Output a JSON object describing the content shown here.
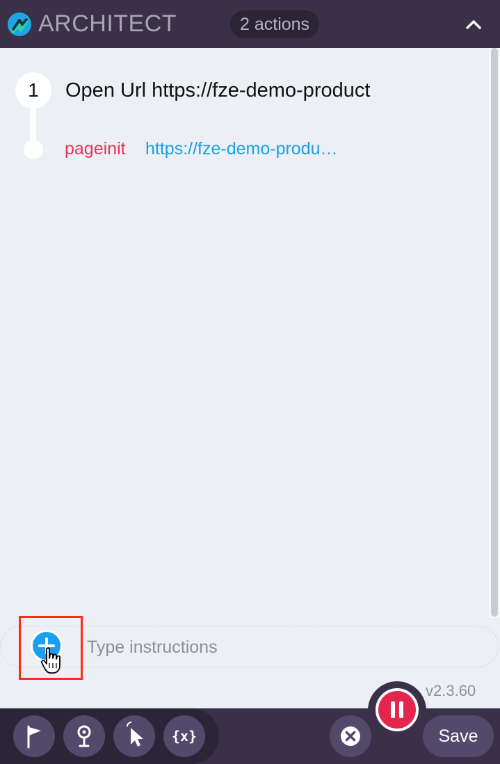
{
  "header": {
    "brand": "ARCHITECT",
    "actions_count": "2 actions",
    "logo_icon": "architect-logo-icon",
    "collapse_icon": "chevron-up-icon"
  },
  "steps": [
    {
      "number": "1",
      "title": "Open Url https://fze-demo-product",
      "event": {
        "name": "pageinit",
        "url": "https://fze-demo-produ…"
      }
    }
  ],
  "instructions": {
    "placeholder": "Type instructions",
    "value": ""
  },
  "version": "v2.3.60",
  "footer": {
    "tools": [
      {
        "name": "flag-tool",
        "icon": "flag-icon"
      },
      {
        "name": "assert-tool",
        "icon": "pin-icon"
      },
      {
        "name": "select-element-tool",
        "icon": "pointer-icon"
      },
      {
        "name": "variables-tool",
        "icon": "variable-icon",
        "label": "{x}"
      }
    ],
    "cancel_icon": "close-icon",
    "pause_icon": "pause-icon",
    "save_label": "Save"
  },
  "colors": {
    "header_bg": "#3a3148",
    "panel_bg": "#ecf0f4",
    "event_name": "#e8335f",
    "event_url": "#1aa0e8",
    "pause": "#e4264f",
    "add_button": "#1a9ff0",
    "highlight": "#ff2a1a"
  }
}
